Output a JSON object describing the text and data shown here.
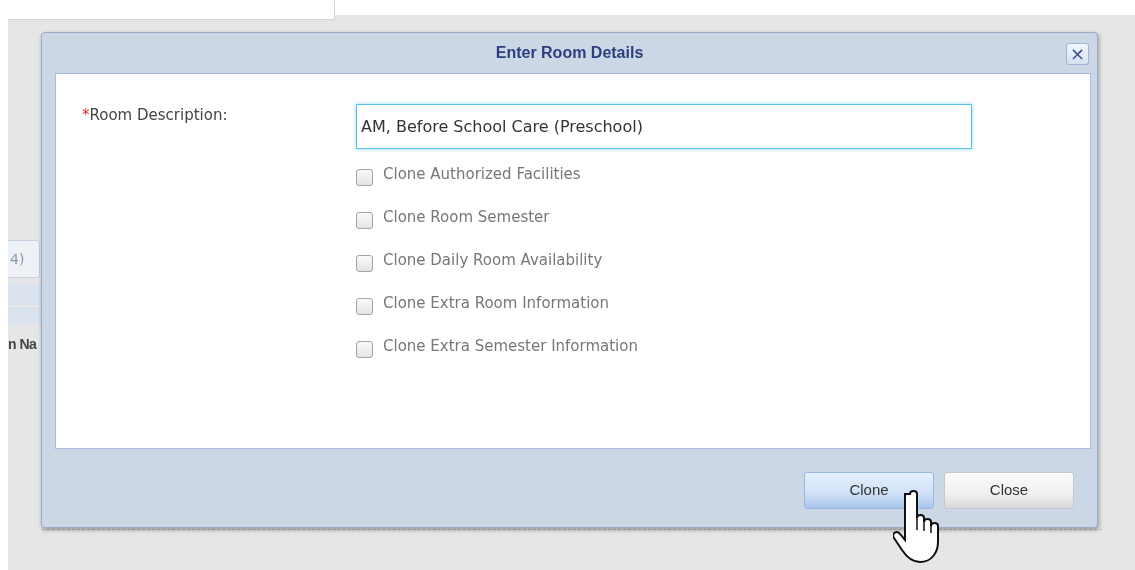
{
  "background": {
    "tab_fragment": "4)",
    "column_fragment": "n Na"
  },
  "dialog": {
    "title": "Enter Room Details",
    "close_icon": "×",
    "field": {
      "required_mark": "*",
      "label": "Room Description:",
      "value": "AM, Before School Care (Preschool)"
    },
    "options": [
      {
        "label": "Clone Authorized Facilities",
        "checked": false
      },
      {
        "label": "Clone Room Semester",
        "checked": false
      },
      {
        "label": "Clone Daily Room Availability",
        "checked": false
      },
      {
        "label": "Clone Extra Room Information",
        "checked": false
      },
      {
        "label": "Clone Extra Semester Information",
        "checked": false
      }
    ],
    "buttons": [
      {
        "label": "Clone",
        "selected": true
      },
      {
        "label": "Close",
        "selected": false
      }
    ]
  }
}
